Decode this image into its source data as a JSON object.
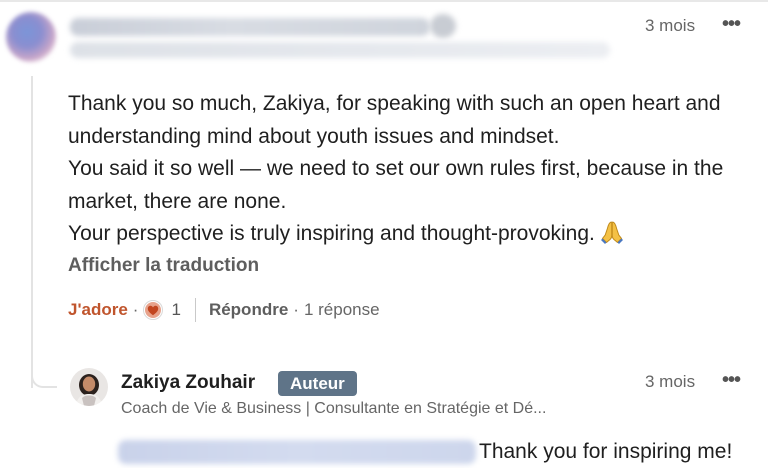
{
  "comment": {
    "time": "3 mois",
    "menu_icon": "more-horizontal-icon",
    "text_lines": [
      "Thank you so much, Zakiya, for speaking with such an open heart and",
      "understanding mind about youth issues and mindset.",
      "You said it so well — we need to set our own rules first, because in the",
      "market, there are none.",
      "Your perspective is truly inspiring and thought-provoking."
    ],
    "emoji_icon": "folded-hands-icon",
    "translate_label": "Afficher la traduction",
    "reaction_label": "J'adore",
    "reaction_icon": "heart-icon",
    "reaction_count": "1",
    "reply_label": "Répondre",
    "reply_count": "1 réponse"
  },
  "reply": {
    "author_name": "Zakiya Zouhair",
    "author_badge": "Auteur",
    "author_headline": "Coach de Vie & Business | Consultante en Stratégie et Dé...",
    "time": "3 mois",
    "menu_icon": "more-horizontal-icon",
    "text": "Thank you for inspiring me!"
  },
  "colors": {
    "reaction_accent": "#c0552d",
    "badge_background": "#5f7488",
    "muted_text": "#5e5e5e"
  }
}
